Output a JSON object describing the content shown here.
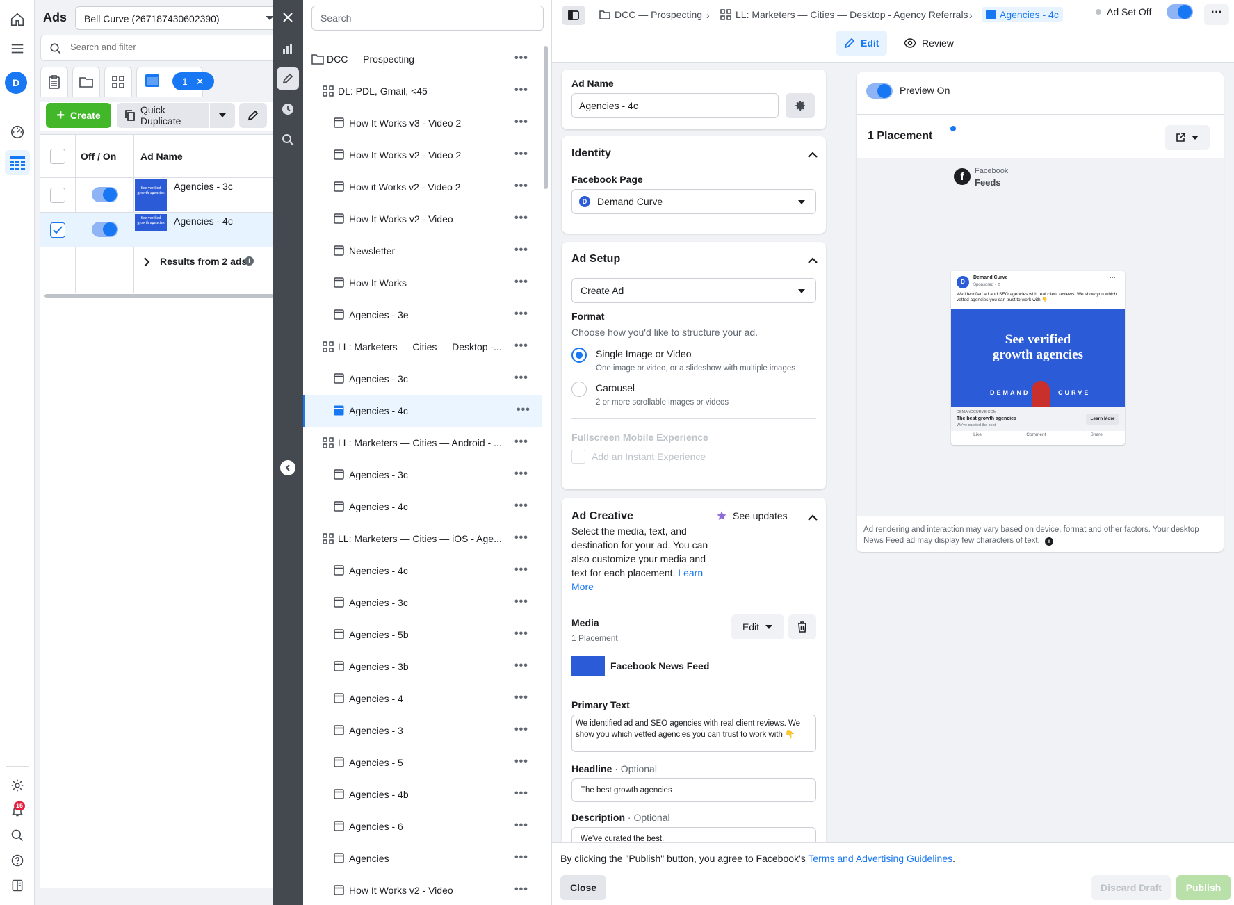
{
  "rail": {
    "avatar_letter": "D",
    "notif_count": "15"
  },
  "ads": {
    "title": "Ads",
    "account": "Bell Curve (267187430602390)",
    "search_placeholder": "Search and filter",
    "selected_count": "1",
    "create_label": "Create",
    "duplicate_label": "Quick Duplicate",
    "col_toggle": "Off / On",
    "col_name": "Ad Name",
    "rows": [
      {
        "name": "Agencies - 3c",
        "thumb_text": "See verified growth agencies"
      },
      {
        "name": "Agencies - 4c",
        "thumb_text": "See verified growth agencies"
      }
    ],
    "results_label": "Results from 2 ads"
  },
  "tree": {
    "search_placeholder": "Search",
    "items": [
      {
        "label": "DCC — Prospecting",
        "type": "campaign"
      },
      {
        "label": "DL: PDL, Gmail, <45",
        "type": "adset"
      },
      {
        "label": "How It Works v3 - Video 2",
        "type": "ad"
      },
      {
        "label": "How It Works v2 - Video 2",
        "type": "ad"
      },
      {
        "label": "How it Works v2 - Video 2",
        "type": "ad"
      },
      {
        "label": "How It Works v2 - Video",
        "type": "ad"
      },
      {
        "label": "Newsletter",
        "type": "ad"
      },
      {
        "label": "How It Works",
        "type": "ad"
      },
      {
        "label": "Agencies - 3e",
        "type": "ad"
      },
      {
        "label": "LL: Marketers — Cities — Desktop -...",
        "type": "adset"
      },
      {
        "label": "Agencies - 3c",
        "type": "ad"
      },
      {
        "label": "Agencies - 4c",
        "type": "ad",
        "active": true
      },
      {
        "label": "LL: Marketers — Cities — Android - ...",
        "type": "adset"
      },
      {
        "label": "Agencies - 3c",
        "type": "ad"
      },
      {
        "label": "Agencies - 4c",
        "type": "ad"
      },
      {
        "label": "LL: Marketers — Cities — iOS - Age...",
        "type": "adset"
      },
      {
        "label": "Agencies - 4c",
        "type": "ad"
      },
      {
        "label": "Agencies - 3c",
        "type": "ad"
      },
      {
        "label": "Agencies - 5b",
        "type": "ad"
      },
      {
        "label": "Agencies - 3b",
        "type": "ad"
      },
      {
        "label": "Agencies - 4",
        "type": "ad"
      },
      {
        "label": "Agencies - 3",
        "type": "ad"
      },
      {
        "label": "Agencies - 5",
        "type": "ad"
      },
      {
        "label": "Agencies - 4b",
        "type": "ad"
      },
      {
        "label": "Agencies - 6",
        "type": "ad"
      },
      {
        "label": "Agencies",
        "type": "ad"
      },
      {
        "label": "How It Works v2 - Video",
        "type": "ad"
      }
    ]
  },
  "editor": {
    "breadcrumbs": [
      "DCC — Prospecting",
      "LL: Marketers — Cities — Desktop - Agency Referrals",
      "Agencies - 4c"
    ],
    "adset_status": "Ad Set Off",
    "tab_edit": "Edit",
    "tab_review": "Review",
    "ad_name_label": "Ad Name",
    "ad_name_value": "Agencies - 4c",
    "identity_title": "Identity",
    "fb_page_label": "Facebook Page",
    "fb_page_value": "Demand Curve",
    "setup_title": "Ad Setup",
    "setup_value": "Create Ad",
    "format_label": "Format",
    "format_help": "Choose how you'd like to structure your ad.",
    "format_single": "Single Image or Video",
    "format_single_help": "One image or video, or a slideshow with multiple images",
    "format_carousel": "Carousel",
    "format_carousel_help": "2 or more scrollable images or videos",
    "fullscreen_label": "Fullscreen Mobile Experience",
    "instant_label": "Add an Instant Experience",
    "creative_title": "Ad Creative",
    "see_updates": "See updates",
    "creative_help": "Select the media, text, and destination for your ad. You can also customize your media and text for each placement.",
    "learn_more": "Learn More",
    "media_label": "Media",
    "media_sub": "1 Placement",
    "media_edit": "Edit",
    "media_placement": "Facebook News Feed",
    "primary_label": "Primary Text",
    "primary_value": "We identified ad and SEO agencies with real client reviews. We show you which vetted agencies you can trust to work with 👇",
    "headline_label": "Headline",
    "optional": "· Optional",
    "headline_value": "The best growth agencies",
    "description_label": "Description",
    "description_value": "We've curated the best."
  },
  "preview": {
    "toggle_label": "Preview On",
    "placements": "1 Placement",
    "platform": "Facebook",
    "placement": "Feeds",
    "page_name": "Demand Curve",
    "sponsored": "Sponsored · ⊙",
    "post_text": "We identified ad and SEO agencies with real client reviews. We show you which vetted agencies you can trust to work with 👇",
    "image_headline": "See verified growth agencies",
    "brand_left": "DEMAND",
    "brand_right": "CURVE",
    "domain": "DEMANDCURVE.COM",
    "headline": "The best growth agencies",
    "desc": "We've curated the best.",
    "cta": "Learn More",
    "like": "Like",
    "comment": "Comment",
    "share": "Share",
    "disclaimer": "Ad rendering and interaction may vary based on device, format and other factors. Your desktop News Feed ad may display few characters of text."
  },
  "footer": {
    "agreement": "By clicking the \"Publish\" button, you agree to Facebook's ",
    "agreement_link": "Terms and Advertising Guidelines",
    "close": "Close",
    "discard": "Discard Draft",
    "publish": "Publish"
  },
  "colors": {
    "accent": "#1877f2",
    "create_green": "#42b72a",
    "publish_disabled": "#b8e0a8"
  }
}
